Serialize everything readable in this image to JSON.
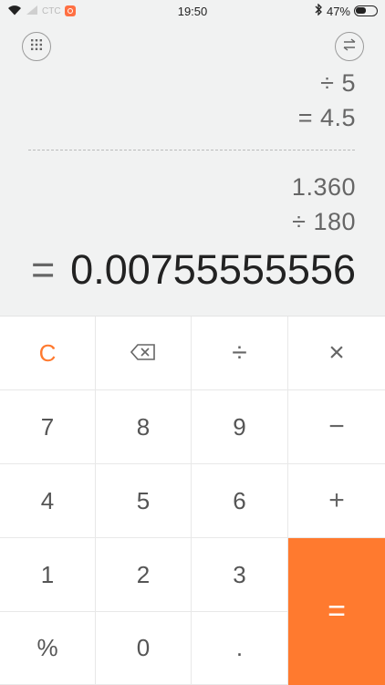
{
  "status": {
    "time": "19:50",
    "battery": "47%",
    "carrier": "CTC"
  },
  "history": [
    {
      "text": "÷  5"
    },
    {
      "text": "=  4.5"
    },
    {
      "text": "1.360"
    },
    {
      "text": "÷  180"
    }
  ],
  "result": {
    "operator": "=",
    "value": "0.00755555556"
  },
  "keys": {
    "clear": "C",
    "divide": "÷",
    "multiply": "×",
    "seven": "7",
    "eight": "8",
    "nine": "9",
    "minus": "−",
    "four": "4",
    "five": "5",
    "six": "6",
    "plus": "+",
    "one": "1",
    "two": "2",
    "three": "3",
    "equals": "=",
    "percent": "%",
    "zero": "0",
    "dot": "."
  },
  "colors": {
    "accent": "#ff7a2f"
  }
}
